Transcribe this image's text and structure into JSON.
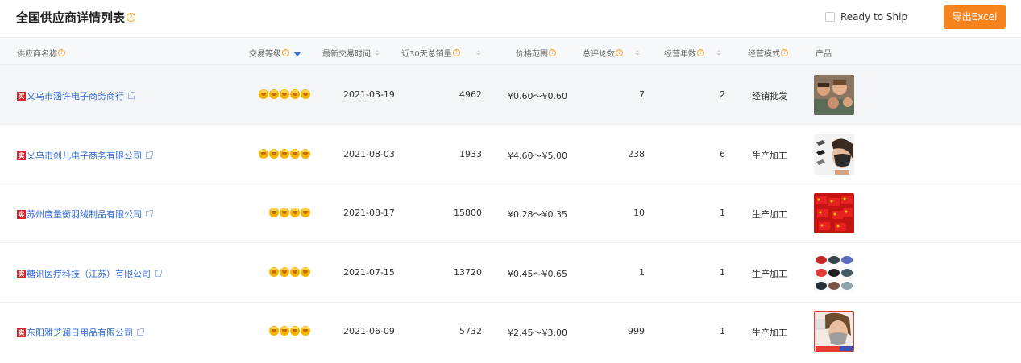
{
  "header": {
    "title": "全国供应商详情列表",
    "ready_to_ship_label": "Ready to Ship",
    "ready_to_ship_checked": false,
    "export_label": "导出Excel"
  },
  "colors": {
    "accent": "#f5841f",
    "link": "#2f6ad9",
    "badge": "#d8232a",
    "highlight_row": "#f4f5f7"
  },
  "table": {
    "columns": {
      "supplier": "供应商名称",
      "level": "交易等级",
      "last_trade": "最新交易时间",
      "sales_30d": "近30天总销量",
      "price_range": "价格范围",
      "reviews": "总评论数",
      "years": "经营年数",
      "mode": "经营模式",
      "product": "产品"
    },
    "sorted_column": "level",
    "sort_direction": "descending",
    "badge_text": "实",
    "rows": [
      {
        "supplier": "义乌市涵许电子商务商行",
        "crowns": 5,
        "last_trade": "2021-03-19",
        "sales_30d": "4962",
        "price_range": "¥0.60～¥0.60",
        "reviews": "7",
        "years": "2",
        "mode": "经销批发",
        "product_icon": "family-photo-thumbnail",
        "highlighted": true
      },
      {
        "supplier": "义乌市创儿电子商务有限公司",
        "crowns": 5,
        "last_trade": "2021-08-03",
        "sales_30d": "1933",
        "price_range": "¥4.60～¥5.00",
        "reviews": "238",
        "years": "6",
        "mode": "生产加工",
        "product_icon": "face-mask-thumbnail",
        "highlighted": false
      },
      {
        "supplier": "苏州度量衡羽绒制品有限公司",
        "crowns": 4,
        "last_trade": "2021-08-17",
        "sales_30d": "15800",
        "price_range": "¥0.28～¥0.35",
        "reviews": "10",
        "years": "1",
        "mode": "生产加工",
        "product_icon": "red-flags-thumbnail",
        "highlighted": false
      },
      {
        "supplier": "糖讯医疗科技（江苏）有限公司",
        "crowns": 4,
        "last_trade": "2021-07-15",
        "sales_30d": "13720",
        "price_range": "¥0.45～¥0.65",
        "reviews": "1",
        "years": "1",
        "mode": "生产加工",
        "product_icon": "hats-grid-thumbnail",
        "highlighted": false
      },
      {
        "supplier": "东阳雅芝澜日用品有限公司",
        "crowns": 4,
        "last_trade": "2021-06-09",
        "sales_30d": "5732",
        "price_range": "¥2.45～¥3.00",
        "reviews": "999",
        "years": "1",
        "mode": "生产加工",
        "product_icon": "mask-model-thumbnail",
        "highlighted": false
      }
    ]
  }
}
